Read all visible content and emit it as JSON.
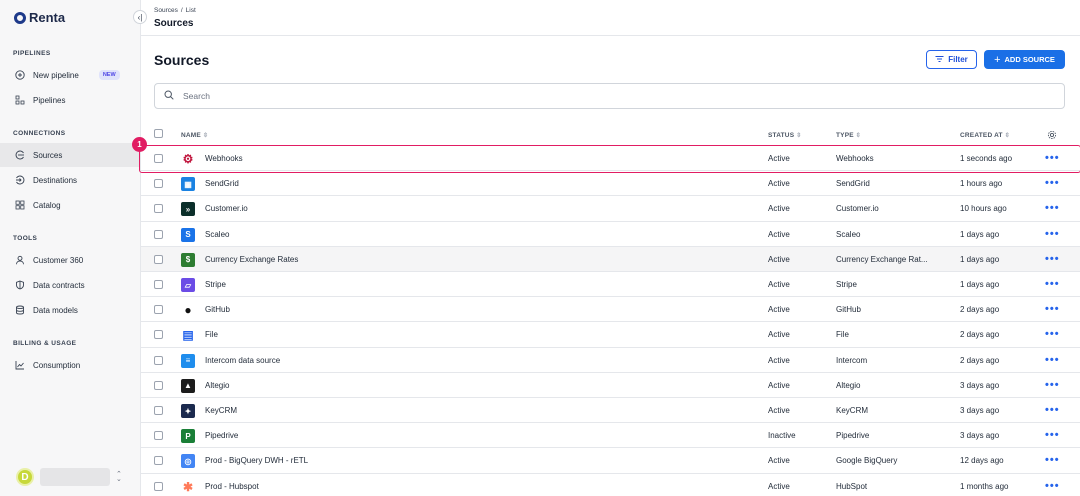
{
  "app": {
    "name": "Renta"
  },
  "sidebar": {
    "sections": [
      {
        "title": "PIPELINES",
        "items": [
          {
            "label": "New pipeline",
            "icon": "plus-circle-icon",
            "badge": "NEW"
          },
          {
            "label": "Pipelines",
            "icon": "pipelines-icon"
          }
        ]
      },
      {
        "title": "CONNECTIONS",
        "items": [
          {
            "label": "Sources",
            "icon": "source-icon",
            "active": true
          },
          {
            "label": "Destinations",
            "icon": "destination-icon"
          },
          {
            "label": "Catalog",
            "icon": "grid-icon"
          }
        ]
      },
      {
        "title": "TOOLS",
        "items": [
          {
            "label": "Customer 360",
            "icon": "user-icon"
          },
          {
            "label": "Data contracts",
            "icon": "shield-icon"
          },
          {
            "label": "Data models",
            "icon": "database-icon"
          }
        ]
      },
      {
        "title": "BILLING & USAGE",
        "items": [
          {
            "label": "Consumption",
            "icon": "chart-icon"
          }
        ]
      }
    ],
    "user": {
      "initial": "D"
    }
  },
  "header": {
    "breadcrumb": [
      "Sources",
      "/",
      "List"
    ],
    "title": "Sources"
  },
  "main": {
    "title": "Sources",
    "filter_label": "Filter",
    "add_label": "ADD SOURCE",
    "search_placeholder": "Search",
    "step_number": "1"
  },
  "table": {
    "columns": {
      "name": "NAME",
      "status": "STATUS",
      "type": "TYPE",
      "created": "CREATED AT"
    },
    "rows": [
      {
        "name": "Webhooks",
        "status": "Active",
        "type": "Webhooks",
        "created": "1 seconds ago",
        "icon": "webhook-icon",
        "color": "#c0143c"
      },
      {
        "name": "SendGrid",
        "status": "Active",
        "type": "SendGrid",
        "created": "1 hours ago",
        "icon": "sendgrid-icon",
        "color": "#1a82e2"
      },
      {
        "name": "Customer.io",
        "status": "Active",
        "type": "Customer.io",
        "created": "10 hours ago",
        "icon": "customerio-icon",
        "color": "#0b2f2a"
      },
      {
        "name": "Scaleo",
        "status": "Active",
        "type": "Scaleo",
        "created": "1 days ago",
        "icon": "scaleo-icon",
        "color": "#1a73e8"
      },
      {
        "name": "Currency Exchange Rates",
        "status": "Active",
        "type": "Currency Exchange Rat...",
        "created": "1 days ago",
        "icon": "currency-icon",
        "color": "#2e7d32"
      },
      {
        "name": "Stripe",
        "status": "Active",
        "type": "Stripe",
        "created": "1 days ago",
        "icon": "stripe-icon",
        "color": "#6b4ce6"
      },
      {
        "name": "GitHub",
        "status": "Active",
        "type": "GitHub",
        "created": "2 days ago",
        "icon": "github-icon",
        "color": "#111111"
      },
      {
        "name": "File",
        "status": "Active",
        "type": "File",
        "created": "2 days ago",
        "icon": "file-icon",
        "color": "#2563eb"
      },
      {
        "name": "Intercom data source",
        "status": "Active",
        "type": "Intercom",
        "created": "2 days ago",
        "icon": "intercom-icon",
        "color": "#1f8ded"
      },
      {
        "name": "Altegio",
        "status": "Active",
        "type": "Altegio",
        "created": "3 days ago",
        "icon": "altegio-icon",
        "color": "#1c1c1c"
      },
      {
        "name": "KeyCRM",
        "status": "Active",
        "type": "KeyCRM",
        "created": "3 days ago",
        "icon": "keycrm-icon",
        "color": "#1b2a4e"
      },
      {
        "name": "Pipedrive",
        "status": "Inactive",
        "type": "Pipedrive",
        "created": "3 days ago",
        "icon": "pipedrive-icon",
        "color": "#1a7f37"
      },
      {
        "name": "Prod - BigQuery DWH - rETL",
        "status": "Active",
        "type": "Google BigQuery",
        "created": "12 days ago",
        "icon": "bigquery-icon",
        "color": "#4285f4"
      },
      {
        "name": "Prod - Hubspot",
        "status": "Active",
        "type": "HubSpot",
        "created": "1 months ago",
        "icon": "hubspot-icon",
        "color": "#ff7a59"
      }
    ]
  }
}
